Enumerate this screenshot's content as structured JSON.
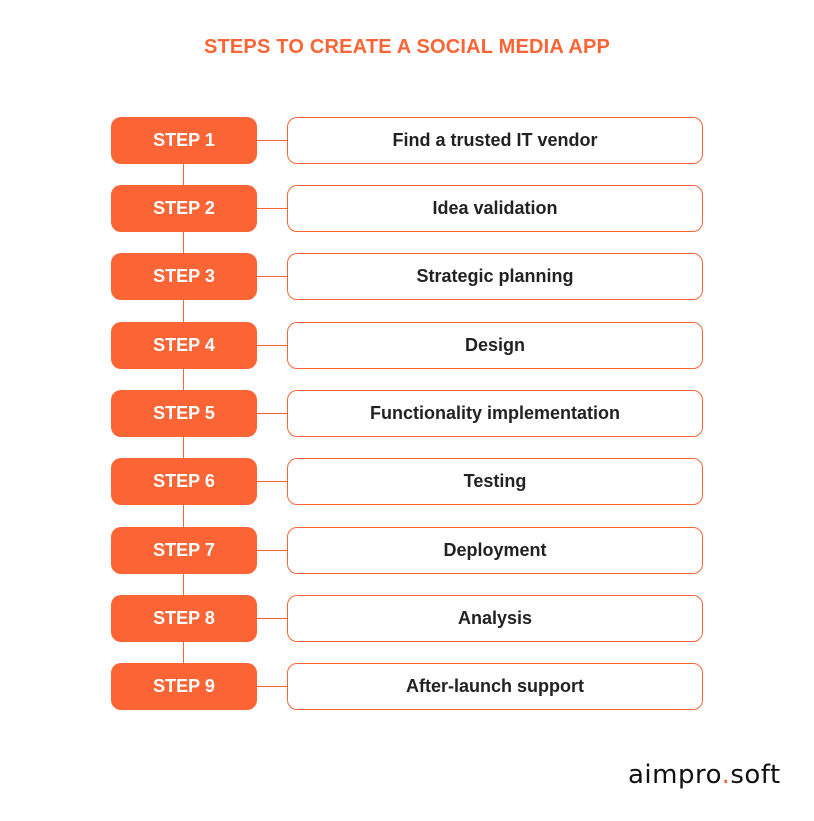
{
  "title": "STEPS TO CREATE A SOCIAL MEDIA APP",
  "accent_color": "#fb6535",
  "steps": [
    {
      "badge": "STEP 1",
      "label": "Find a trusted IT vendor"
    },
    {
      "badge": "STEP 2",
      "label": "Idea validation"
    },
    {
      "badge": "STEP 3",
      "label": "Strategic planning"
    },
    {
      "badge": "STEP 4",
      "label": "Design"
    },
    {
      "badge": "STEP 5",
      "label": "Functionality implementation"
    },
    {
      "badge": "STEP 6",
      "label": "Testing"
    },
    {
      "badge": "STEP 7",
      "label": "Deployment"
    },
    {
      "badge": "STEP 8",
      "label": "Analysis"
    },
    {
      "badge": "STEP 9",
      "label": "After-launch support"
    }
  ],
  "logo": {
    "part1": "aimpro",
    "dot": ".",
    "part2": "soft"
  }
}
